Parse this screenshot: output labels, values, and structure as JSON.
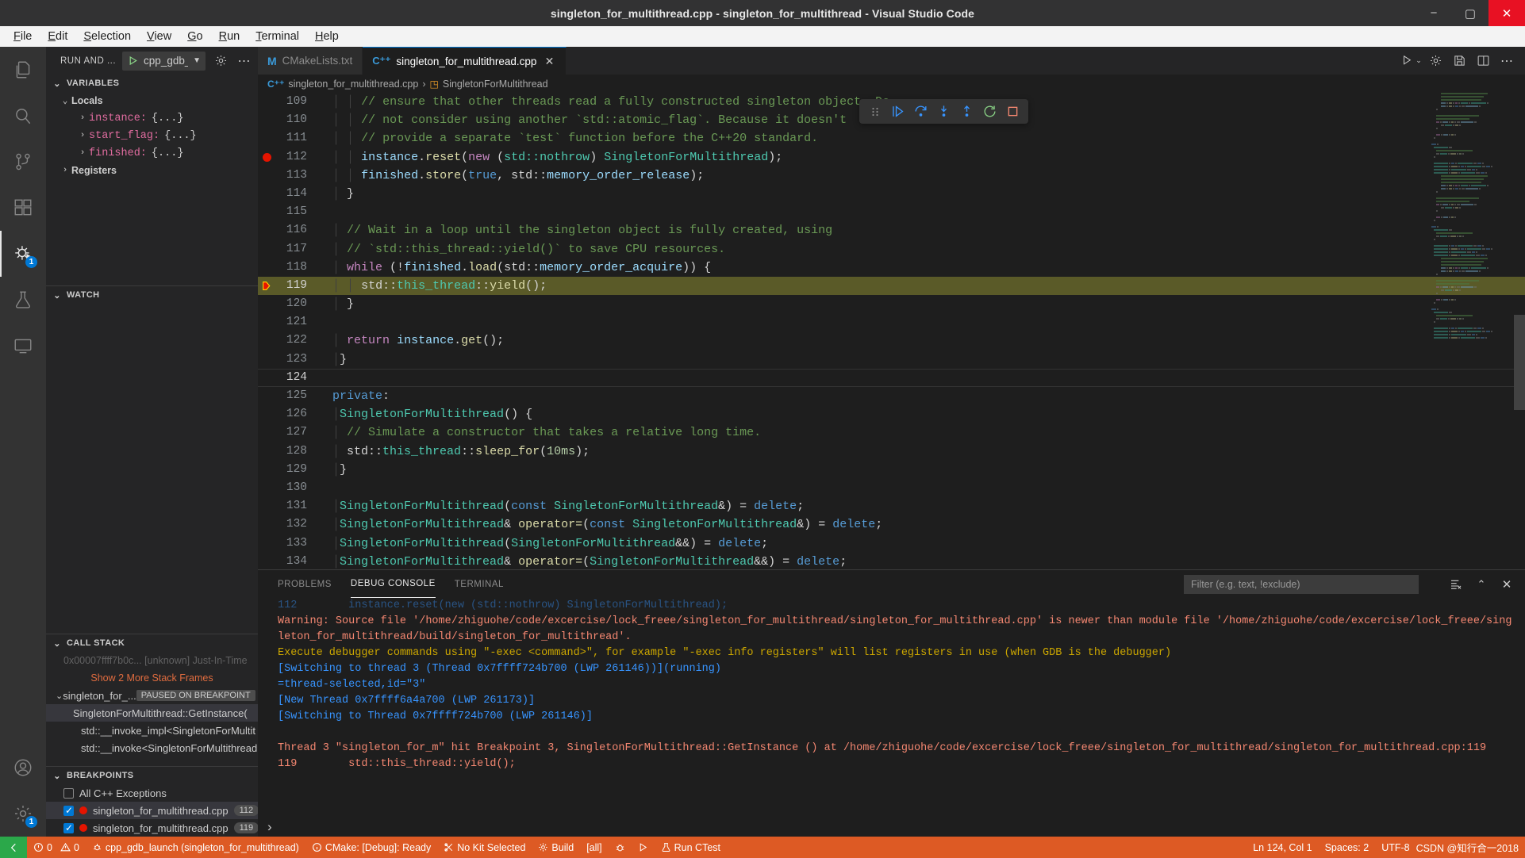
{
  "window": {
    "title": "singleton_for_multithread.cpp - singleton_for_multithread - Visual Studio Code",
    "minimize": "−",
    "maximize": "▢",
    "close": "✕"
  },
  "menubar": {
    "items": [
      "File",
      "Edit",
      "Selection",
      "View",
      "Go",
      "Run",
      "Terminal",
      "Help"
    ]
  },
  "activitybar": {
    "items": [
      {
        "name": "explorer-icon",
        "badge": ""
      },
      {
        "name": "search-icon",
        "badge": ""
      },
      {
        "name": "source-control-icon",
        "badge": ""
      },
      {
        "name": "extensions-icon",
        "badge": ""
      },
      {
        "name": "run-and-debug-icon",
        "badge": "1"
      },
      {
        "name": "testing-icon",
        "badge": ""
      },
      {
        "name": "remote-explorer-icon",
        "badge": ""
      }
    ],
    "bottom": [
      {
        "name": "accounts-icon",
        "badge": ""
      },
      {
        "name": "settings-gear-icon",
        "badge": "1"
      }
    ]
  },
  "sidebar": {
    "header_title": "RUN AND ...",
    "launch_config": "cpp_gdb_laur",
    "gear_icon": "gear-icon",
    "more_icon": "more-icon",
    "variables": {
      "title": "VARIABLES",
      "scopes": [
        {
          "label": "Locals",
          "items": [
            {
              "name": "instance:",
              "value": "{...}"
            },
            {
              "name": "start_flag:",
              "value": "{...}"
            },
            {
              "name": "finished:",
              "value": "{...}"
            }
          ]
        },
        {
          "label": "Registers",
          "items": []
        }
      ]
    },
    "watch": {
      "title": "WATCH"
    },
    "callstack": {
      "title": "CALL STACK",
      "top_partial": "0x00007ffff7b0c... [unknown] Just-In-Time",
      "show_more": "Show 2 More Stack Frames",
      "thread_label": "singleton_for_...",
      "paused_badge": "PAUSED ON BREAKPOINT",
      "frames": [
        "SingletonForMultithread::GetInstance(",
        "std::__invoke_impl<SingletonForMultit",
        "std::__invoke<SingletonForMultithread"
      ]
    },
    "breakpoints": {
      "title": "BREAKPOINTS",
      "items": [
        {
          "type": "checkbox",
          "checked": false,
          "label": "All C++ Exceptions",
          "line": ""
        },
        {
          "type": "bp",
          "checked": true,
          "label": "singleton_for_multithread.cpp",
          "line": "112"
        },
        {
          "type": "bp",
          "checked": true,
          "label": "singleton_for_multithread.cpp",
          "line": "119"
        }
      ]
    }
  },
  "tabs": [
    {
      "label": "CMakeLists.txt",
      "icon": "cmake-file-icon",
      "active": false,
      "closable": false
    },
    {
      "label": "singleton_for_multithread.cpp",
      "icon": "cpp-file-icon",
      "active": true,
      "closable": true,
      "close": "✕"
    }
  ],
  "editor_actions": [
    "run-or-debug-icon",
    "settings-gear-icon",
    "save-all-icon",
    "split-editor-icon",
    "more-actions-icon"
  ],
  "breadcrumb": {
    "file_icon": "cpp-file-icon",
    "file": "singleton_for_multithread.cpp",
    "separator": "›",
    "symbol_icon": "class-symbol-icon",
    "symbol": "SingletonForMultithread"
  },
  "debug_toolbar": {
    "buttons": [
      {
        "name": "drag-handle-icon",
        "title": "drag"
      },
      {
        "name": "continue-icon",
        "title": "Continue"
      },
      {
        "name": "step-over-icon",
        "title": "Step Over"
      },
      {
        "name": "step-into-icon",
        "title": "Step Into"
      },
      {
        "name": "step-out-icon",
        "title": "Step Out"
      },
      {
        "name": "restart-icon",
        "title": "Restart"
      },
      {
        "name": "stop-icon",
        "title": "Stop"
      }
    ]
  },
  "code": {
    "first_line": 109,
    "exec_line": 119,
    "cursor_line": 124,
    "breakpoint_lines": [
      112
    ],
    "lines": [
      {
        "n": 109,
        "indent": 4,
        "tokens": [
          {
            "t": "// ensure that other threads read a fully constructed singleton object. Do",
            "c": "c-com"
          }
        ]
      },
      {
        "n": 110,
        "indent": 4,
        "tokens": [
          {
            "t": "// not consider using another `std::atomic_flag`. Because it doesn't",
            "c": "c-com"
          }
        ]
      },
      {
        "n": 111,
        "indent": 4,
        "tokens": [
          {
            "t": "// provide a separate `test` function before the C++20 standard.",
            "c": "c-com"
          }
        ]
      },
      {
        "n": 112,
        "indent": 4,
        "tokens": [
          {
            "t": "instance",
            "c": "c-var"
          },
          {
            "t": ".",
            "c": "c-pln"
          },
          {
            "t": "reset",
            "c": "c-fn"
          },
          {
            "t": "(",
            "c": "c-pln"
          },
          {
            "t": "new",
            "c": "c-kw"
          },
          {
            "t": " (",
            "c": "c-pln"
          },
          {
            "t": "std::nothrow",
            "c": "c-typ"
          },
          {
            "t": ") ",
            "c": "c-pln"
          },
          {
            "t": "SingletonForMultithread",
            "c": "c-typ"
          },
          {
            "t": ");",
            "c": "c-pln"
          }
        ]
      },
      {
        "n": 113,
        "indent": 4,
        "tokens": [
          {
            "t": "finished",
            "c": "c-var"
          },
          {
            "t": ".",
            "c": "c-pln"
          },
          {
            "t": "store",
            "c": "c-fn"
          },
          {
            "t": "(",
            "c": "c-pln"
          },
          {
            "t": "true",
            "c": "c-kw2"
          },
          {
            "t": ", ",
            "c": "c-pln"
          },
          {
            "t": "std::",
            "c": "c-pln"
          },
          {
            "t": "memory_order_release",
            "c": "c-var"
          },
          {
            "t": ");",
            "c": "c-pln"
          }
        ]
      },
      {
        "n": 114,
        "indent": 2,
        "tokens": [
          {
            "t": "}",
            "c": "c-pln"
          }
        ]
      },
      {
        "n": 115,
        "indent": 0,
        "tokens": []
      },
      {
        "n": 116,
        "indent": 2,
        "tokens": [
          {
            "t": "// Wait in a loop until the singleton object is fully created, using",
            "c": "c-com"
          }
        ]
      },
      {
        "n": 117,
        "indent": 2,
        "tokens": [
          {
            "t": "// `std::this_thread::yield()` to save CPU resources.",
            "c": "c-com"
          }
        ]
      },
      {
        "n": 118,
        "indent": 2,
        "tokens": [
          {
            "t": "while",
            "c": "c-kw"
          },
          {
            "t": " (!",
            "c": "c-pln"
          },
          {
            "t": "finished",
            "c": "c-var"
          },
          {
            "t": ".",
            "c": "c-pln"
          },
          {
            "t": "load",
            "c": "c-fn"
          },
          {
            "t": "(",
            "c": "c-pln"
          },
          {
            "t": "std::",
            "c": "c-pln"
          },
          {
            "t": "memory_order_acquire",
            "c": "c-var"
          },
          {
            "t": ")) {",
            "c": "c-pln"
          }
        ]
      },
      {
        "n": 119,
        "indent": 4,
        "tokens": [
          {
            "t": "std::",
            "c": "c-pln"
          },
          {
            "t": "this_thread",
            "c": "c-typ"
          },
          {
            "t": "::",
            "c": "c-pln"
          },
          {
            "t": "yield",
            "c": "c-fn"
          },
          {
            "t": "();",
            "c": "c-pln"
          }
        ]
      },
      {
        "n": 120,
        "indent": 2,
        "tokens": [
          {
            "t": "}",
            "c": "c-pln"
          }
        ]
      },
      {
        "n": 121,
        "indent": 0,
        "tokens": []
      },
      {
        "n": 122,
        "indent": 2,
        "tokens": [
          {
            "t": "return",
            "c": "c-kw"
          },
          {
            "t": " ",
            "c": "c-pln"
          },
          {
            "t": "instance",
            "c": "c-var"
          },
          {
            "t": ".",
            "c": "c-pln"
          },
          {
            "t": "get",
            "c": "c-fn"
          },
          {
            "t": "();",
            "c": "c-pln"
          }
        ]
      },
      {
        "n": 123,
        "indent": 1,
        "tokens": [
          {
            "t": "}",
            "c": "c-pln"
          }
        ]
      },
      {
        "n": 124,
        "indent": 0,
        "tokens": []
      },
      {
        "n": 125,
        "indent": 0,
        "tokens": [
          {
            "t": "private",
            "c": "c-kw2"
          },
          {
            "t": ":",
            "c": "c-pln"
          }
        ]
      },
      {
        "n": 126,
        "indent": 1,
        "tokens": [
          {
            "t": "SingletonForMultithread",
            "c": "c-typ"
          },
          {
            "t": "() {",
            "c": "c-pln"
          }
        ]
      },
      {
        "n": 127,
        "indent": 2,
        "tokens": [
          {
            "t": "// Simulate a constructor that takes a relative long time.",
            "c": "c-com"
          }
        ]
      },
      {
        "n": 128,
        "indent": 2,
        "tokens": [
          {
            "t": "std::",
            "c": "c-pln"
          },
          {
            "t": "this_thread",
            "c": "c-typ"
          },
          {
            "t": "::",
            "c": "c-pln"
          },
          {
            "t": "sleep_for",
            "c": "c-fn"
          },
          {
            "t": "(",
            "c": "c-pln"
          },
          {
            "t": "10ms",
            "c": "c-num"
          },
          {
            "t": ");",
            "c": "c-pln"
          }
        ]
      },
      {
        "n": 129,
        "indent": 1,
        "tokens": [
          {
            "t": "}",
            "c": "c-pln"
          }
        ]
      },
      {
        "n": 130,
        "indent": 0,
        "tokens": []
      },
      {
        "n": 131,
        "indent": 1,
        "tokens": [
          {
            "t": "SingletonForMultithread",
            "c": "c-typ"
          },
          {
            "t": "(",
            "c": "c-pln"
          },
          {
            "t": "const",
            "c": "c-kw2"
          },
          {
            "t": " ",
            "c": "c-pln"
          },
          {
            "t": "SingletonForMultithread",
            "c": "c-typ"
          },
          {
            "t": "&) = ",
            "c": "c-pln"
          },
          {
            "t": "delete",
            "c": "c-kw2"
          },
          {
            "t": ";",
            "c": "c-pln"
          }
        ]
      },
      {
        "n": 132,
        "indent": 1,
        "tokens": [
          {
            "t": "SingletonForMultithread",
            "c": "c-typ"
          },
          {
            "t": "& ",
            "c": "c-pln"
          },
          {
            "t": "operator=",
            "c": "c-fn"
          },
          {
            "t": "(",
            "c": "c-pln"
          },
          {
            "t": "const",
            "c": "c-kw2"
          },
          {
            "t": " ",
            "c": "c-pln"
          },
          {
            "t": "SingletonForMultithread",
            "c": "c-typ"
          },
          {
            "t": "&) = ",
            "c": "c-pln"
          },
          {
            "t": "delete",
            "c": "c-kw2"
          },
          {
            "t": ";",
            "c": "c-pln"
          }
        ]
      },
      {
        "n": 133,
        "indent": 1,
        "tokens": [
          {
            "t": "SingletonForMultithread",
            "c": "c-typ"
          },
          {
            "t": "(",
            "c": "c-pln"
          },
          {
            "t": "SingletonForMultithread",
            "c": "c-typ"
          },
          {
            "t": "&&) = ",
            "c": "c-pln"
          },
          {
            "t": "delete",
            "c": "c-kw2"
          },
          {
            "t": ";",
            "c": "c-pln"
          }
        ]
      },
      {
        "n": 134,
        "indent": 1,
        "tokens": [
          {
            "t": "SingletonForMultithread",
            "c": "c-typ"
          },
          {
            "t": "& ",
            "c": "c-pln"
          },
          {
            "t": "operator=",
            "c": "c-fn"
          },
          {
            "t": "(",
            "c": "c-pln"
          },
          {
            "t": "SingletonForMultithread",
            "c": "c-typ"
          },
          {
            "t": "&&) = ",
            "c": "c-pln"
          },
          {
            "t": "delete",
            "c": "c-kw2"
          },
          {
            "t": ";",
            "c": "c-pln"
          }
        ]
      }
    ]
  },
  "panel": {
    "tabs": [
      {
        "label": "PROBLEMS",
        "active": false
      },
      {
        "label": "DEBUG CONSOLE",
        "active": true
      },
      {
        "label": "TERMINAL",
        "active": false
      }
    ],
    "filter_placeholder": "Filter (e.g. text, !exclude)",
    "actions": [
      "clear-console-icon",
      "chevron-up-icon",
      "close-icon"
    ],
    "console_lines": [
      {
        "text": "112        instance.reset(new (std::nothrow) SingletonForMultithread);",
        "c": "ch-blue",
        "dim": true
      },
      {
        "text": "Warning: Source file '/home/zhiguohe/code/excercise/lock_freee/singleton_for_multithread/singleton_for_multithread.cpp' is newer than module file '/home/zhiguohe/code/excercise/lock_freee/singleton_for_multithread/build/singleton_for_multithread'.",
        "c": "ch-red"
      },
      {
        "text": "Execute debugger commands using \"-exec <command>\", for example \"-exec info registers\" will list registers in use (when GDB is the debugger)",
        "c": "ch-org"
      },
      {
        "text": "[Switching to thread 3 (Thread 0x7ffff724b700 (LWP 261146))](running)",
        "c": "ch-blue"
      },
      {
        "text": "=thread-selected,id=\"3\"",
        "c": "ch-blue"
      },
      {
        "text": "[New Thread 0x7ffff6a4a700 (LWP 261173)]",
        "c": "ch-blue"
      },
      {
        "text": "[Switching to Thread 0x7ffff724b700 (LWP 261146)]",
        "c": "ch-blue"
      },
      {
        "text": "",
        "c": "ch-wht"
      },
      {
        "text": "Thread 3 \"singleton_for_m\" hit Breakpoint 3, SingletonForMultithread::GetInstance () at /home/zhiguohe/code/excercise/lock_freee/singleton_for_multithread/singleton_for_multithread.cpp:119",
        "c": "ch-red"
      },
      {
        "text": "119        std::this_thread::yield();",
        "c": "ch-red"
      }
    ],
    "prompt": "›"
  },
  "statusbar": {
    "remote_icon": "remote-window-icon",
    "left": [
      {
        "icon": "error-icon",
        "text": "0",
        "icon2": "warning-icon",
        "text2": "0",
        "name": "problems-status"
      },
      {
        "icon": "debug-icon",
        "text": "cpp_gdb_launch (singleton_for_multithread)",
        "name": "launch-config-status"
      },
      {
        "icon": "info-icon",
        "text": "CMake: [Debug]: Ready",
        "name": "cmake-status"
      },
      {
        "icon": "kit-icon",
        "text": "No Kit Selected",
        "name": "kit-status"
      },
      {
        "icon": "build-icon",
        "text": "Build",
        "name": "build-status"
      },
      {
        "icon": "",
        "text": "[all]",
        "name": "target-status"
      },
      {
        "icon": "bug-icon",
        "text": "",
        "name": "debug-status"
      },
      {
        "icon": "play-icon",
        "text": "",
        "name": "launch-status"
      },
      {
        "icon": "ctest-icon",
        "text": "Run CTest",
        "name": "ctest-status"
      }
    ],
    "right": [
      {
        "text": "Ln 124, Col 1",
        "name": "cursor-position-status"
      },
      {
        "text": "Spaces: 2",
        "name": "indentation-status"
      },
      {
        "text": "UTF-8",
        "name": "encoding-status"
      }
    ],
    "watermark": "CSDN @知行合一2018"
  }
}
